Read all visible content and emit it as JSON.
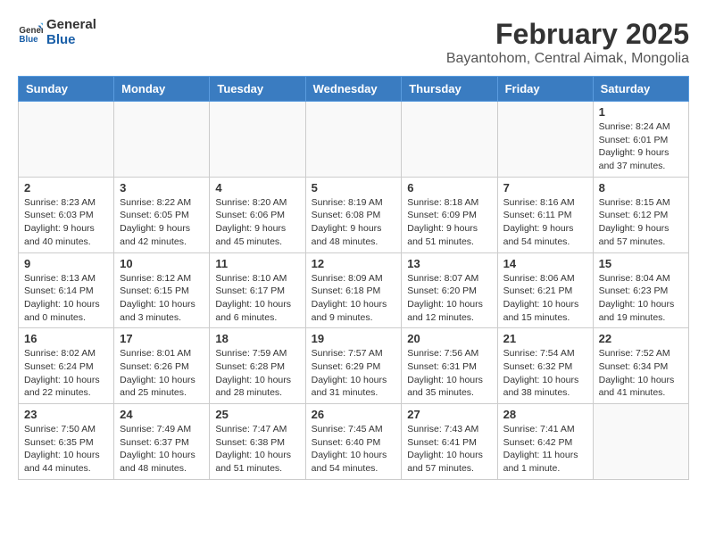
{
  "header": {
    "logo_line1": "General",
    "logo_line2": "Blue",
    "title": "February 2025",
    "subtitle": "Bayantohom, Central Aimak, Mongolia"
  },
  "calendar": {
    "days_of_week": [
      "Sunday",
      "Monday",
      "Tuesday",
      "Wednesday",
      "Thursday",
      "Friday",
      "Saturday"
    ],
    "weeks": [
      [
        {
          "day": "",
          "info": ""
        },
        {
          "day": "",
          "info": ""
        },
        {
          "day": "",
          "info": ""
        },
        {
          "day": "",
          "info": ""
        },
        {
          "day": "",
          "info": ""
        },
        {
          "day": "",
          "info": ""
        },
        {
          "day": "1",
          "info": "Sunrise: 8:24 AM\nSunset: 6:01 PM\nDaylight: 9 hours and 37 minutes."
        }
      ],
      [
        {
          "day": "2",
          "info": "Sunrise: 8:23 AM\nSunset: 6:03 PM\nDaylight: 9 hours and 40 minutes."
        },
        {
          "day": "3",
          "info": "Sunrise: 8:22 AM\nSunset: 6:05 PM\nDaylight: 9 hours and 42 minutes."
        },
        {
          "day": "4",
          "info": "Sunrise: 8:20 AM\nSunset: 6:06 PM\nDaylight: 9 hours and 45 minutes."
        },
        {
          "day": "5",
          "info": "Sunrise: 8:19 AM\nSunset: 6:08 PM\nDaylight: 9 hours and 48 minutes."
        },
        {
          "day": "6",
          "info": "Sunrise: 8:18 AM\nSunset: 6:09 PM\nDaylight: 9 hours and 51 minutes."
        },
        {
          "day": "7",
          "info": "Sunrise: 8:16 AM\nSunset: 6:11 PM\nDaylight: 9 hours and 54 minutes."
        },
        {
          "day": "8",
          "info": "Sunrise: 8:15 AM\nSunset: 6:12 PM\nDaylight: 9 hours and 57 minutes."
        }
      ],
      [
        {
          "day": "9",
          "info": "Sunrise: 8:13 AM\nSunset: 6:14 PM\nDaylight: 10 hours and 0 minutes."
        },
        {
          "day": "10",
          "info": "Sunrise: 8:12 AM\nSunset: 6:15 PM\nDaylight: 10 hours and 3 minutes."
        },
        {
          "day": "11",
          "info": "Sunrise: 8:10 AM\nSunset: 6:17 PM\nDaylight: 10 hours and 6 minutes."
        },
        {
          "day": "12",
          "info": "Sunrise: 8:09 AM\nSunset: 6:18 PM\nDaylight: 10 hours and 9 minutes."
        },
        {
          "day": "13",
          "info": "Sunrise: 8:07 AM\nSunset: 6:20 PM\nDaylight: 10 hours and 12 minutes."
        },
        {
          "day": "14",
          "info": "Sunrise: 8:06 AM\nSunset: 6:21 PM\nDaylight: 10 hours and 15 minutes."
        },
        {
          "day": "15",
          "info": "Sunrise: 8:04 AM\nSunset: 6:23 PM\nDaylight: 10 hours and 19 minutes."
        }
      ],
      [
        {
          "day": "16",
          "info": "Sunrise: 8:02 AM\nSunset: 6:24 PM\nDaylight: 10 hours and 22 minutes."
        },
        {
          "day": "17",
          "info": "Sunrise: 8:01 AM\nSunset: 6:26 PM\nDaylight: 10 hours and 25 minutes."
        },
        {
          "day": "18",
          "info": "Sunrise: 7:59 AM\nSunset: 6:28 PM\nDaylight: 10 hours and 28 minutes."
        },
        {
          "day": "19",
          "info": "Sunrise: 7:57 AM\nSunset: 6:29 PM\nDaylight: 10 hours and 31 minutes."
        },
        {
          "day": "20",
          "info": "Sunrise: 7:56 AM\nSunset: 6:31 PM\nDaylight: 10 hours and 35 minutes."
        },
        {
          "day": "21",
          "info": "Sunrise: 7:54 AM\nSunset: 6:32 PM\nDaylight: 10 hours and 38 minutes."
        },
        {
          "day": "22",
          "info": "Sunrise: 7:52 AM\nSunset: 6:34 PM\nDaylight: 10 hours and 41 minutes."
        }
      ],
      [
        {
          "day": "23",
          "info": "Sunrise: 7:50 AM\nSunset: 6:35 PM\nDaylight: 10 hours and 44 minutes."
        },
        {
          "day": "24",
          "info": "Sunrise: 7:49 AM\nSunset: 6:37 PM\nDaylight: 10 hours and 48 minutes."
        },
        {
          "day": "25",
          "info": "Sunrise: 7:47 AM\nSunset: 6:38 PM\nDaylight: 10 hours and 51 minutes."
        },
        {
          "day": "26",
          "info": "Sunrise: 7:45 AM\nSunset: 6:40 PM\nDaylight: 10 hours and 54 minutes."
        },
        {
          "day": "27",
          "info": "Sunrise: 7:43 AM\nSunset: 6:41 PM\nDaylight: 10 hours and 57 minutes."
        },
        {
          "day": "28",
          "info": "Sunrise: 7:41 AM\nSunset: 6:42 PM\nDaylight: 11 hours and 1 minute."
        },
        {
          "day": "",
          "info": ""
        }
      ]
    ]
  }
}
